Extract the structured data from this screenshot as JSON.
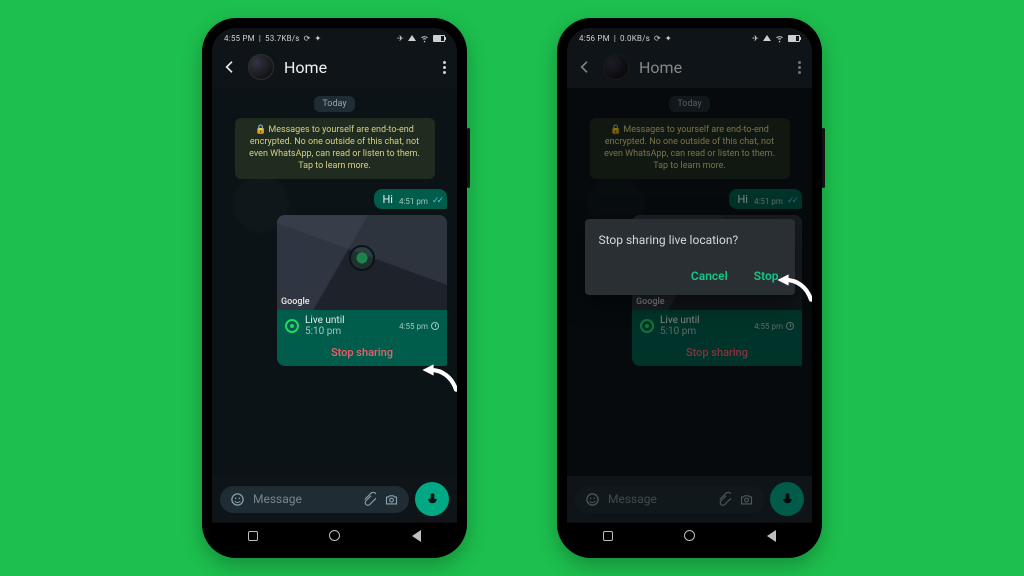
{
  "bg_color": "#1dbf4e",
  "left": {
    "status": {
      "time": "4:55 PM",
      "net": "53.7KB/s"
    },
    "header": {
      "name": "Home"
    },
    "date_label": "Today",
    "encryption_notice": "Messages to yourself are end-to-end encrypted. No one outside of this chat, not even WhatsApp, can read or listen to them. Tap to learn more.",
    "message": {
      "text": "Hi",
      "time": "4:51 pm"
    },
    "location": {
      "map_attribution": "Google",
      "live_label": "Live until",
      "live_until": "5:10 pm",
      "sent_time": "4:55 pm",
      "stop_label": "Stop sharing"
    },
    "input": {
      "placeholder": "Message"
    }
  },
  "right": {
    "status": {
      "time": "4:56 PM",
      "net": "0.0KB/s"
    },
    "header": {
      "name": "Home"
    },
    "date_label": "Today",
    "encryption_notice": "Messages to yourself are end-to-end encrypted. No one outside of this chat, not even WhatsApp, can read or listen to them. Tap to learn more.",
    "message": {
      "text": "Hi",
      "time": "4:51 pm"
    },
    "location": {
      "map_attribution": "Google",
      "live_label": "Live until",
      "live_until": "5:10 pm",
      "sent_time": "4:55 pm",
      "stop_label": "Stop sharing"
    },
    "input": {
      "placeholder": "Message"
    },
    "dialog": {
      "title": "Stop sharing live location?",
      "cancel": "Cancel",
      "stop": "Stop"
    }
  }
}
